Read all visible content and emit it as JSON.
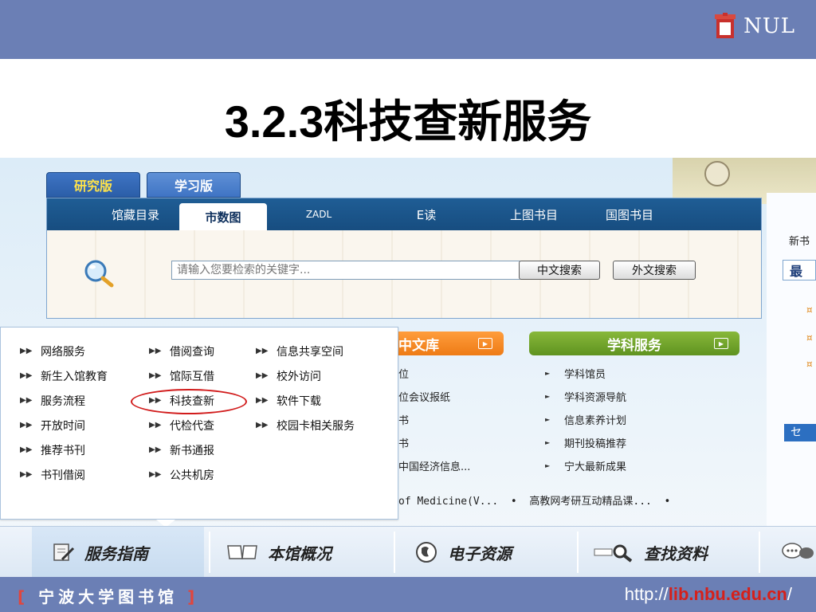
{
  "header": {
    "logo_text": "NUL"
  },
  "slide_title": "3.2.3科技查新服务",
  "version_tabs": [
    {
      "label": "研究版",
      "active": true
    },
    {
      "label": "学习版",
      "active": false
    }
  ],
  "search_tabs": [
    {
      "label": "馆藏目录",
      "active": false
    },
    {
      "label": "市数图",
      "active": true
    },
    {
      "label": "ZADL",
      "active": false
    },
    {
      "label": "E读",
      "active": false
    },
    {
      "label": "上图书目",
      "active": false
    },
    {
      "label": "国图书目",
      "active": false
    }
  ],
  "search": {
    "placeholder": "请输入您要检索的关键字...",
    "btn_chinese": "中文搜索",
    "btn_foreign": "外文搜索"
  },
  "right_panel": {
    "new_books": "新书",
    "tab1": "最",
    "tab2": "セ"
  },
  "dropdown": {
    "col1": [
      "网络服务",
      "新生入馆教育",
      "服务流程",
      "开放时间",
      "推荐书刊",
      "书刊借阅"
    ],
    "col2": [
      "借阅查询",
      "馆际互借",
      "科技查新",
      "代检代查",
      "新书通报",
      "公共机房"
    ],
    "col3": [
      "信息共享空间",
      "校外访问",
      "软件下载",
      "校园卡相关服务"
    ],
    "highlighted": "科技查新"
  },
  "zh_library": {
    "title": "中文库",
    "items": [
      "位",
      "位会议报纸",
      "书",
      "书",
      "中国经济信息..."
    ]
  },
  "subject_service": {
    "title": "学科服务",
    "items": [
      "学科馆员",
      "学科资源导航",
      "信息素养计划",
      "期刊投稿推荐",
      "宁大最新成果"
    ]
  },
  "ticker": {
    "text1": "of Medicine(V...",
    "text2": "高教网考研互动精品课..."
  },
  "bottom_nav": [
    {
      "label": "服务指南",
      "icon": "pencil-doc-icon",
      "active": true
    },
    {
      "label": "本馆概况",
      "icon": "book-icon",
      "active": false
    },
    {
      "label": "电子资源",
      "icon": "globe-icon",
      "active": false
    },
    {
      "label": "查找资料",
      "icon": "magnifier-icon",
      "active": false
    }
  ],
  "footer": {
    "library_name": "宁波大学图书馆",
    "bracket_open": "[",
    "bracket_close": "]",
    "url_prefix": "http://",
    "url_host": "lib.nbu.edu.cn",
    "url_suffix": "/"
  },
  "colors": {
    "banner": "#6b7fb5",
    "nav_dark": "#1f5d95",
    "orange_header": "#ee7b15",
    "green_header": "#5f9320",
    "highlight_circle": "#d11b1b",
    "url_red": "#d6201a"
  }
}
